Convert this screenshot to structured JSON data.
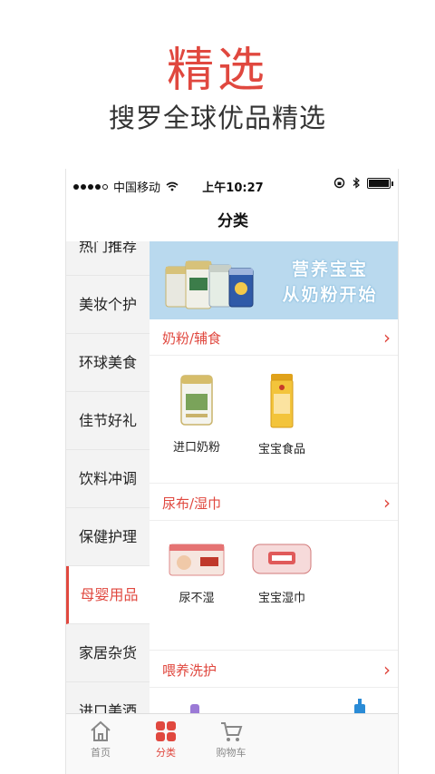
{
  "promo": {
    "title": "精选",
    "subtitle": "搜罗全球优品精选"
  },
  "statusbar": {
    "carrier": "中国移动",
    "time": "上午10:27"
  },
  "navbar": {
    "title": "分类"
  },
  "sidebar": {
    "items": [
      {
        "label": "热门推荐"
      },
      {
        "label": "美妆个护"
      },
      {
        "label": "环球美食"
      },
      {
        "label": "佳节好礼"
      },
      {
        "label": "饮料冲调"
      },
      {
        "label": "保健护理"
      },
      {
        "label": "母婴用品",
        "active": true
      },
      {
        "label": "家居杂货"
      },
      {
        "label": "进口美酒"
      }
    ]
  },
  "banner": {
    "line1": "营养宝宝",
    "line2": "从奶粉开始"
  },
  "sections": [
    {
      "title": "奶粉/辅食",
      "products": [
        {
          "name": "进口奶粉",
          "icon": "milk-powder-can-icon"
        },
        {
          "name": "宝宝食品",
          "icon": "baby-snack-tube-icon"
        }
      ]
    },
    {
      "title": "尿布/湿巾",
      "products": [
        {
          "name": "尿不湿",
          "icon": "diaper-pack-icon"
        },
        {
          "name": "宝宝湿巾",
          "icon": "wet-wipes-pack-icon"
        }
      ]
    },
    {
      "title": "喂养洗护",
      "products": []
    }
  ],
  "tabbar": {
    "tabs": [
      {
        "label": "首页",
        "icon": "home-icon"
      },
      {
        "label": "分类",
        "icon": "category-grid-icon",
        "active": true
      },
      {
        "label": "购物车",
        "icon": "shopping-cart-icon"
      }
    ]
  },
  "colors": {
    "accent": "#e0483f",
    "sidebar_bg": "#f3f3f3",
    "banner_bg": "#b9d9ee"
  }
}
